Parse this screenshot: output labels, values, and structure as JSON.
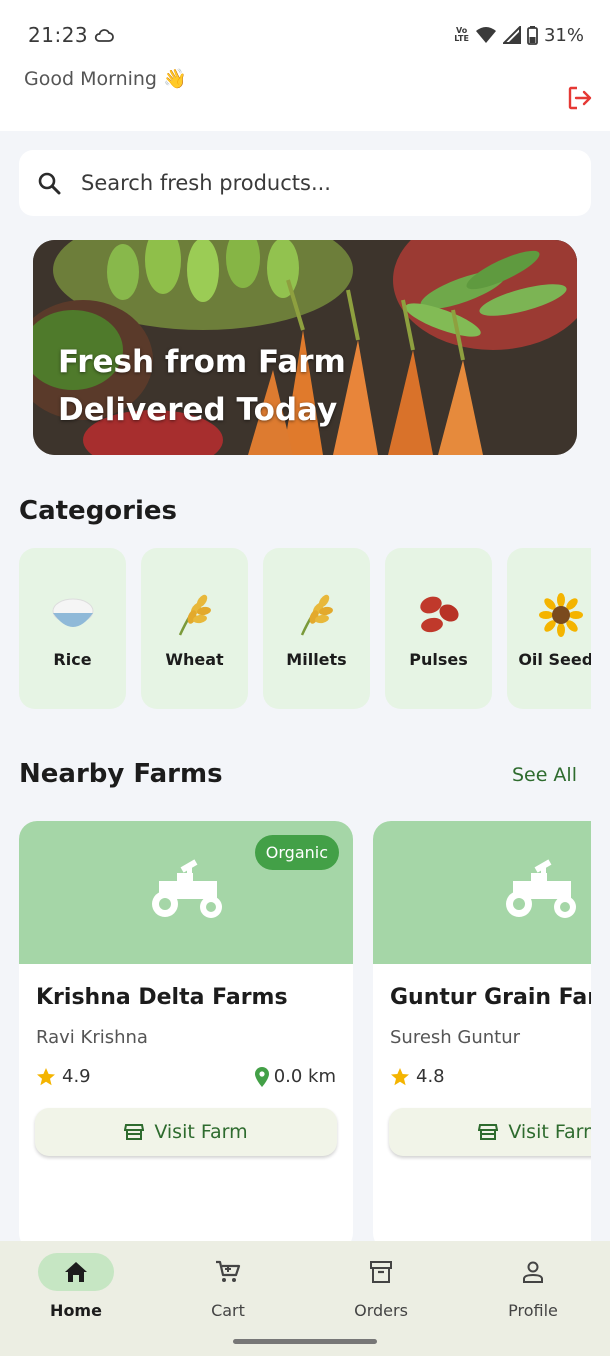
{
  "status_bar": {
    "time": "21:23",
    "network": "Vo LTE",
    "battery": "31%"
  },
  "header": {
    "greeting": "Good Morning",
    "greeting_emoji": "👋"
  },
  "search": {
    "placeholder": "Search fresh products..."
  },
  "banner": {
    "line1": "Fresh from Farm",
    "line2": "Delivered Today"
  },
  "categories": {
    "title": "Categories",
    "items": [
      {
        "label": "Rice",
        "icon": "rice-bowl-icon"
      },
      {
        "label": "Wheat",
        "icon": "wheat-icon"
      },
      {
        "label": "Millets",
        "icon": "wheat-icon"
      },
      {
        "label": "Pulses",
        "icon": "beans-icon"
      },
      {
        "label": "Oil Seeds",
        "icon": "sunflower-icon"
      }
    ]
  },
  "nearby_farms": {
    "title": "Nearby Farms",
    "see_all": "See All",
    "farms": [
      {
        "badge": "Organic",
        "name": "Krishna Delta Farms",
        "owner": "Ravi Krishna",
        "rating": "4.9",
        "distance": "0.0 km",
        "action": "Visit Farm"
      },
      {
        "badge": "",
        "name": "Guntur Grain Farm",
        "owner": "Suresh Guntur",
        "rating": "4.8",
        "distance": "",
        "action": "Visit Farm"
      }
    ]
  },
  "bottom_nav": [
    {
      "label": "Home",
      "icon": "home-icon",
      "active": true
    },
    {
      "label": "Cart",
      "icon": "cart-icon",
      "active": false
    },
    {
      "label": "Orders",
      "icon": "archive-icon",
      "active": false
    },
    {
      "label": "Profile",
      "icon": "person-icon",
      "active": false
    }
  ],
  "colors": {
    "primary": "#2e6b2e",
    "accent": "#43a047",
    "card_hero": "#a5d6a7",
    "category_bg": "#e6f4e4",
    "logout": "#e53935"
  }
}
